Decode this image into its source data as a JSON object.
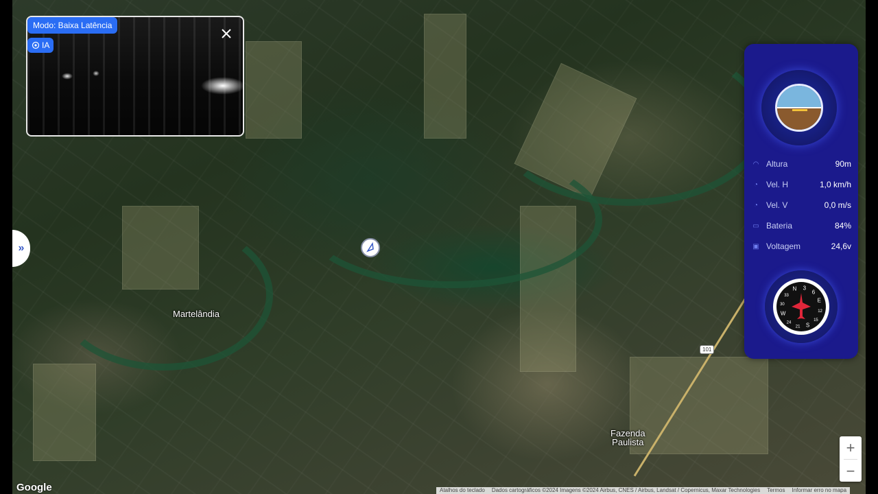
{
  "video": {
    "mode_label": "Modo: Baixa Latência",
    "ia_label": "IA",
    "close_icon": "close-icon"
  },
  "map": {
    "places": [
      {
        "name": "Martelândia"
      },
      {
        "name": "Fazenda\nPaulista"
      }
    ],
    "road_shield": "101",
    "marker_icon": "navigation-arrow-icon"
  },
  "sidebar_toggle": {
    "icon": "double-chevron-right-icon",
    "glyph": "»"
  },
  "telemetry": {
    "rows": [
      {
        "icon": "altitude-icon",
        "label": "Altura",
        "value": "90m"
      },
      {
        "icon": "speedometer-icon",
        "label": "Vel. H",
        "value": "1,0 km/h"
      },
      {
        "icon": "speedometer-icon",
        "label": "Vel. V",
        "value": "0,0 m/s"
      },
      {
        "icon": "battery-icon",
        "label": "Bateria",
        "value": "84%"
      },
      {
        "icon": "voltage-icon",
        "label": "Voltagem",
        "value": "24,6v"
      }
    ],
    "attitude_icon": "attitude-indicator-icon",
    "compass_icon": "compass-icon"
  },
  "compass": {
    "labels": [
      "N",
      "3",
      "6",
      "E",
      "12",
      "15",
      "S",
      "21",
      "24",
      "W",
      "30",
      "33"
    ]
  },
  "zoom": {
    "in_label": "+",
    "out_label": "−"
  },
  "footer": {
    "google": "Google",
    "links": [
      "Atalhos do teclado",
      "Dados cartográficos ©2024 Imagens ©2024 Airbus, CNES / Airbus, Landsat / Copernicus, Maxar Technologies",
      "Termos",
      "Informar erro no mapa"
    ]
  }
}
